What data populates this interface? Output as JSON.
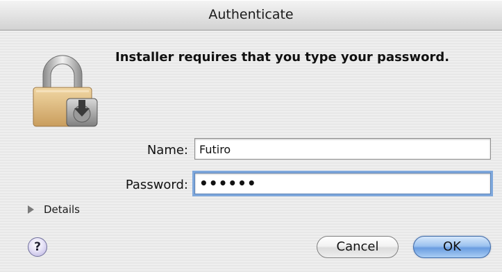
{
  "window": {
    "title": "Authenticate"
  },
  "message": "Installer requires that you type your password.",
  "icon": "padlock-installer-icon",
  "form": {
    "name_label": "Name:",
    "name_value": "Futiro",
    "password_label": "Password:",
    "password_value": "••••••"
  },
  "details": {
    "label": "Details",
    "icon": "disclosure-triangle-icon"
  },
  "buttons": {
    "help": "?",
    "cancel": "Cancel",
    "ok": "OK"
  },
  "colors": {
    "default_button": "#6a9de0",
    "focus_ring": "#7fa8dc"
  }
}
